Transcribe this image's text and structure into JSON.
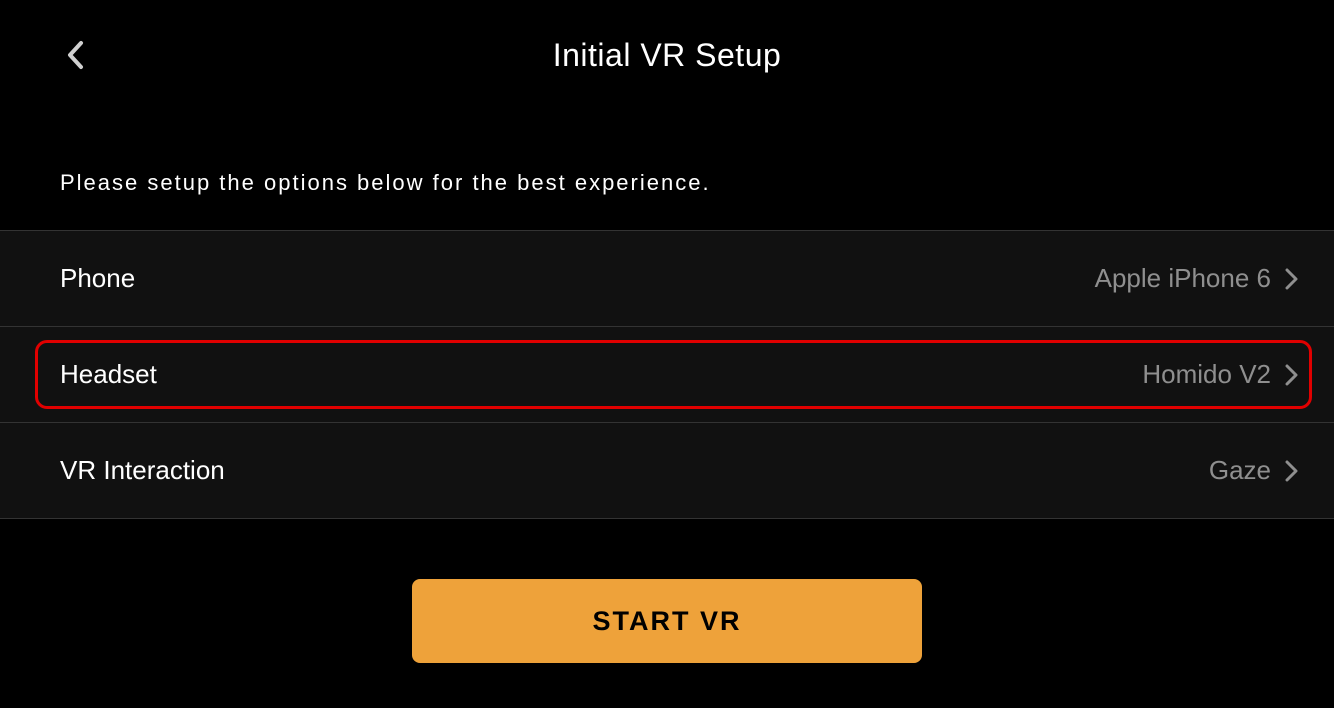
{
  "header": {
    "title": "Initial VR Setup"
  },
  "instruction": "Please setup the options below for the best experience.",
  "options": {
    "phone": {
      "label": "Phone",
      "value": "Apple iPhone 6"
    },
    "headset": {
      "label": "Headset",
      "value": "Homido V2"
    },
    "interaction": {
      "label": "VR Interaction",
      "value": "Gaze"
    }
  },
  "actions": {
    "start_label": "START VR"
  },
  "colors": {
    "accent": "#eea23a",
    "highlight": "#e10000",
    "background": "#000000",
    "row_background": "#111111",
    "text_primary": "#ffffff",
    "text_secondary": "#8f8f8f"
  }
}
